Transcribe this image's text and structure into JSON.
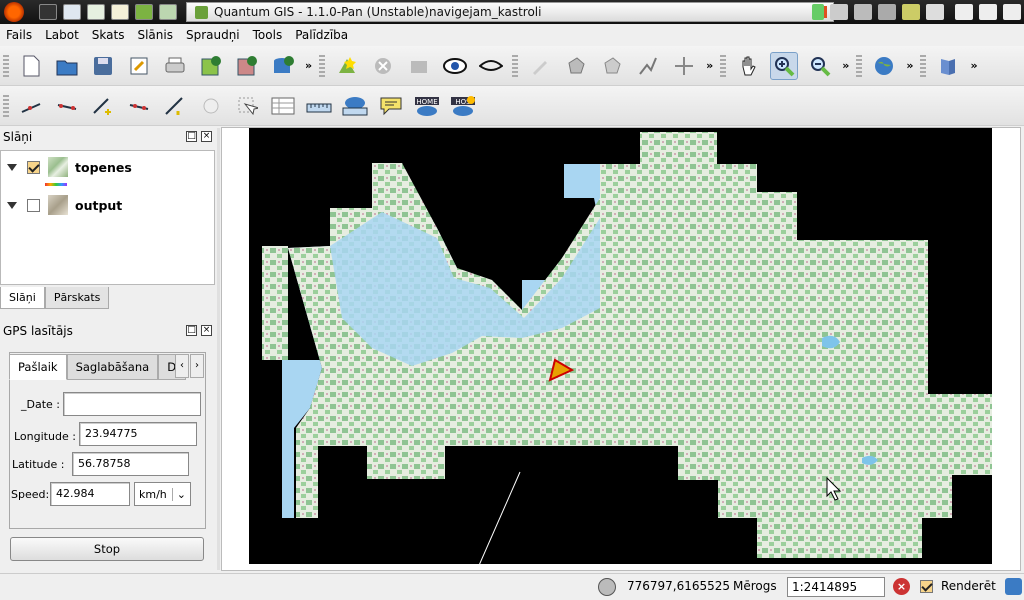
{
  "window": {
    "title": "Quantum GIS - 1.1.0-Pan (Unstable)navigejam_kastroli"
  },
  "menu": [
    "Fails",
    "Labot",
    "Skats",
    "Slānis",
    "Spraudņi",
    "Tools",
    "Palīdzība"
  ],
  "layers_panel": {
    "title": "Slāņi",
    "layers": [
      {
        "name": "topenes",
        "checked": true
      },
      {
        "name": "output",
        "checked": false
      }
    ],
    "tabs": [
      "Slāņi",
      "Pārskats"
    ]
  },
  "gps": {
    "title": "GPS lasītājs",
    "tabs": [
      "Pašlaik",
      "Saglabāšana",
      "Da"
    ],
    "date_label": "_Date :",
    "date_value": "",
    "longitude_label": "Longitude :",
    "longitude_value": "23.94775",
    "latitude_label": "Latitude :",
    "latitude_value": "56.78758",
    "speed_label": "Speed:",
    "speed_value": "42.984",
    "speed_unit": "km/h",
    "stop_label": "Stop"
  },
  "status": {
    "coordinates": "776797,6165525",
    "scale_label": "Mērogs",
    "scale_value": "1:2414895",
    "render_label": "Renderēt",
    "render_checked": true
  },
  "colors": {
    "water": "#a9d6f2",
    "land_green": "#8fc493",
    "land_light": "#eef1ea",
    "nodata": "#000000",
    "gps_marker": "#e8a000"
  }
}
